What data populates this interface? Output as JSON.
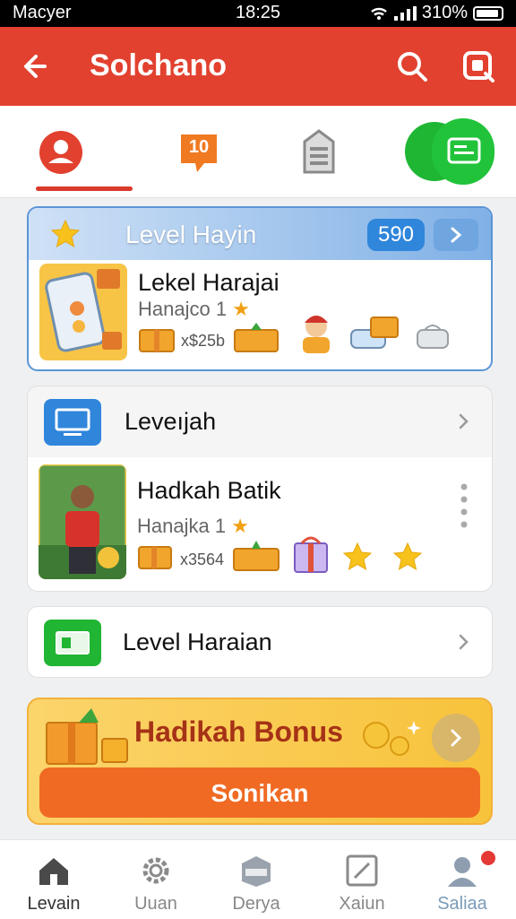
{
  "status_bar": {
    "carrier": "Macyer",
    "time": "18:25",
    "battery": "310%"
  },
  "app_bar": {
    "title": "Solchano"
  },
  "tabs": [
    {
      "icon": "profile-icon",
      "label": ""
    },
    {
      "icon": "chat-badge-icon",
      "badge": "10"
    },
    {
      "icon": "document-icon"
    },
    {
      "icon": "wallet-icon"
    }
  ],
  "level_card": {
    "header": "Level Hayin",
    "badge": "590",
    "title": "Lekel Harajai",
    "sub": "Hanajco 1",
    "price": "x$25b"
  },
  "row_levelah": {
    "label": "Leveıjah"
  },
  "hadiah_card": {
    "title": "Hadkah Batik",
    "sub": "Hanajka 1",
    "price": "x3564"
  },
  "row_harian": {
    "label": "Level Haraian"
  },
  "bonus": {
    "title": "Hadikah Bonus",
    "button": "Sonikan"
  },
  "bottom_nav": [
    {
      "label": "Levain",
      "icon": "home-icon",
      "active": true
    },
    {
      "label": "Uuan",
      "icon": "settings-icon",
      "active": false
    },
    {
      "label": "Derya",
      "icon": "box-icon",
      "active": false
    },
    {
      "label": "Xaiun",
      "icon": "edit-icon",
      "active": false
    },
    {
      "label": "Saliaa",
      "icon": "user-icon",
      "active": false
    }
  ],
  "colors": {
    "primary": "#e2412f",
    "accent": "#2f86db",
    "green": "#21c33a",
    "bonus": "#f8c33b",
    "button": "#f06a23"
  }
}
